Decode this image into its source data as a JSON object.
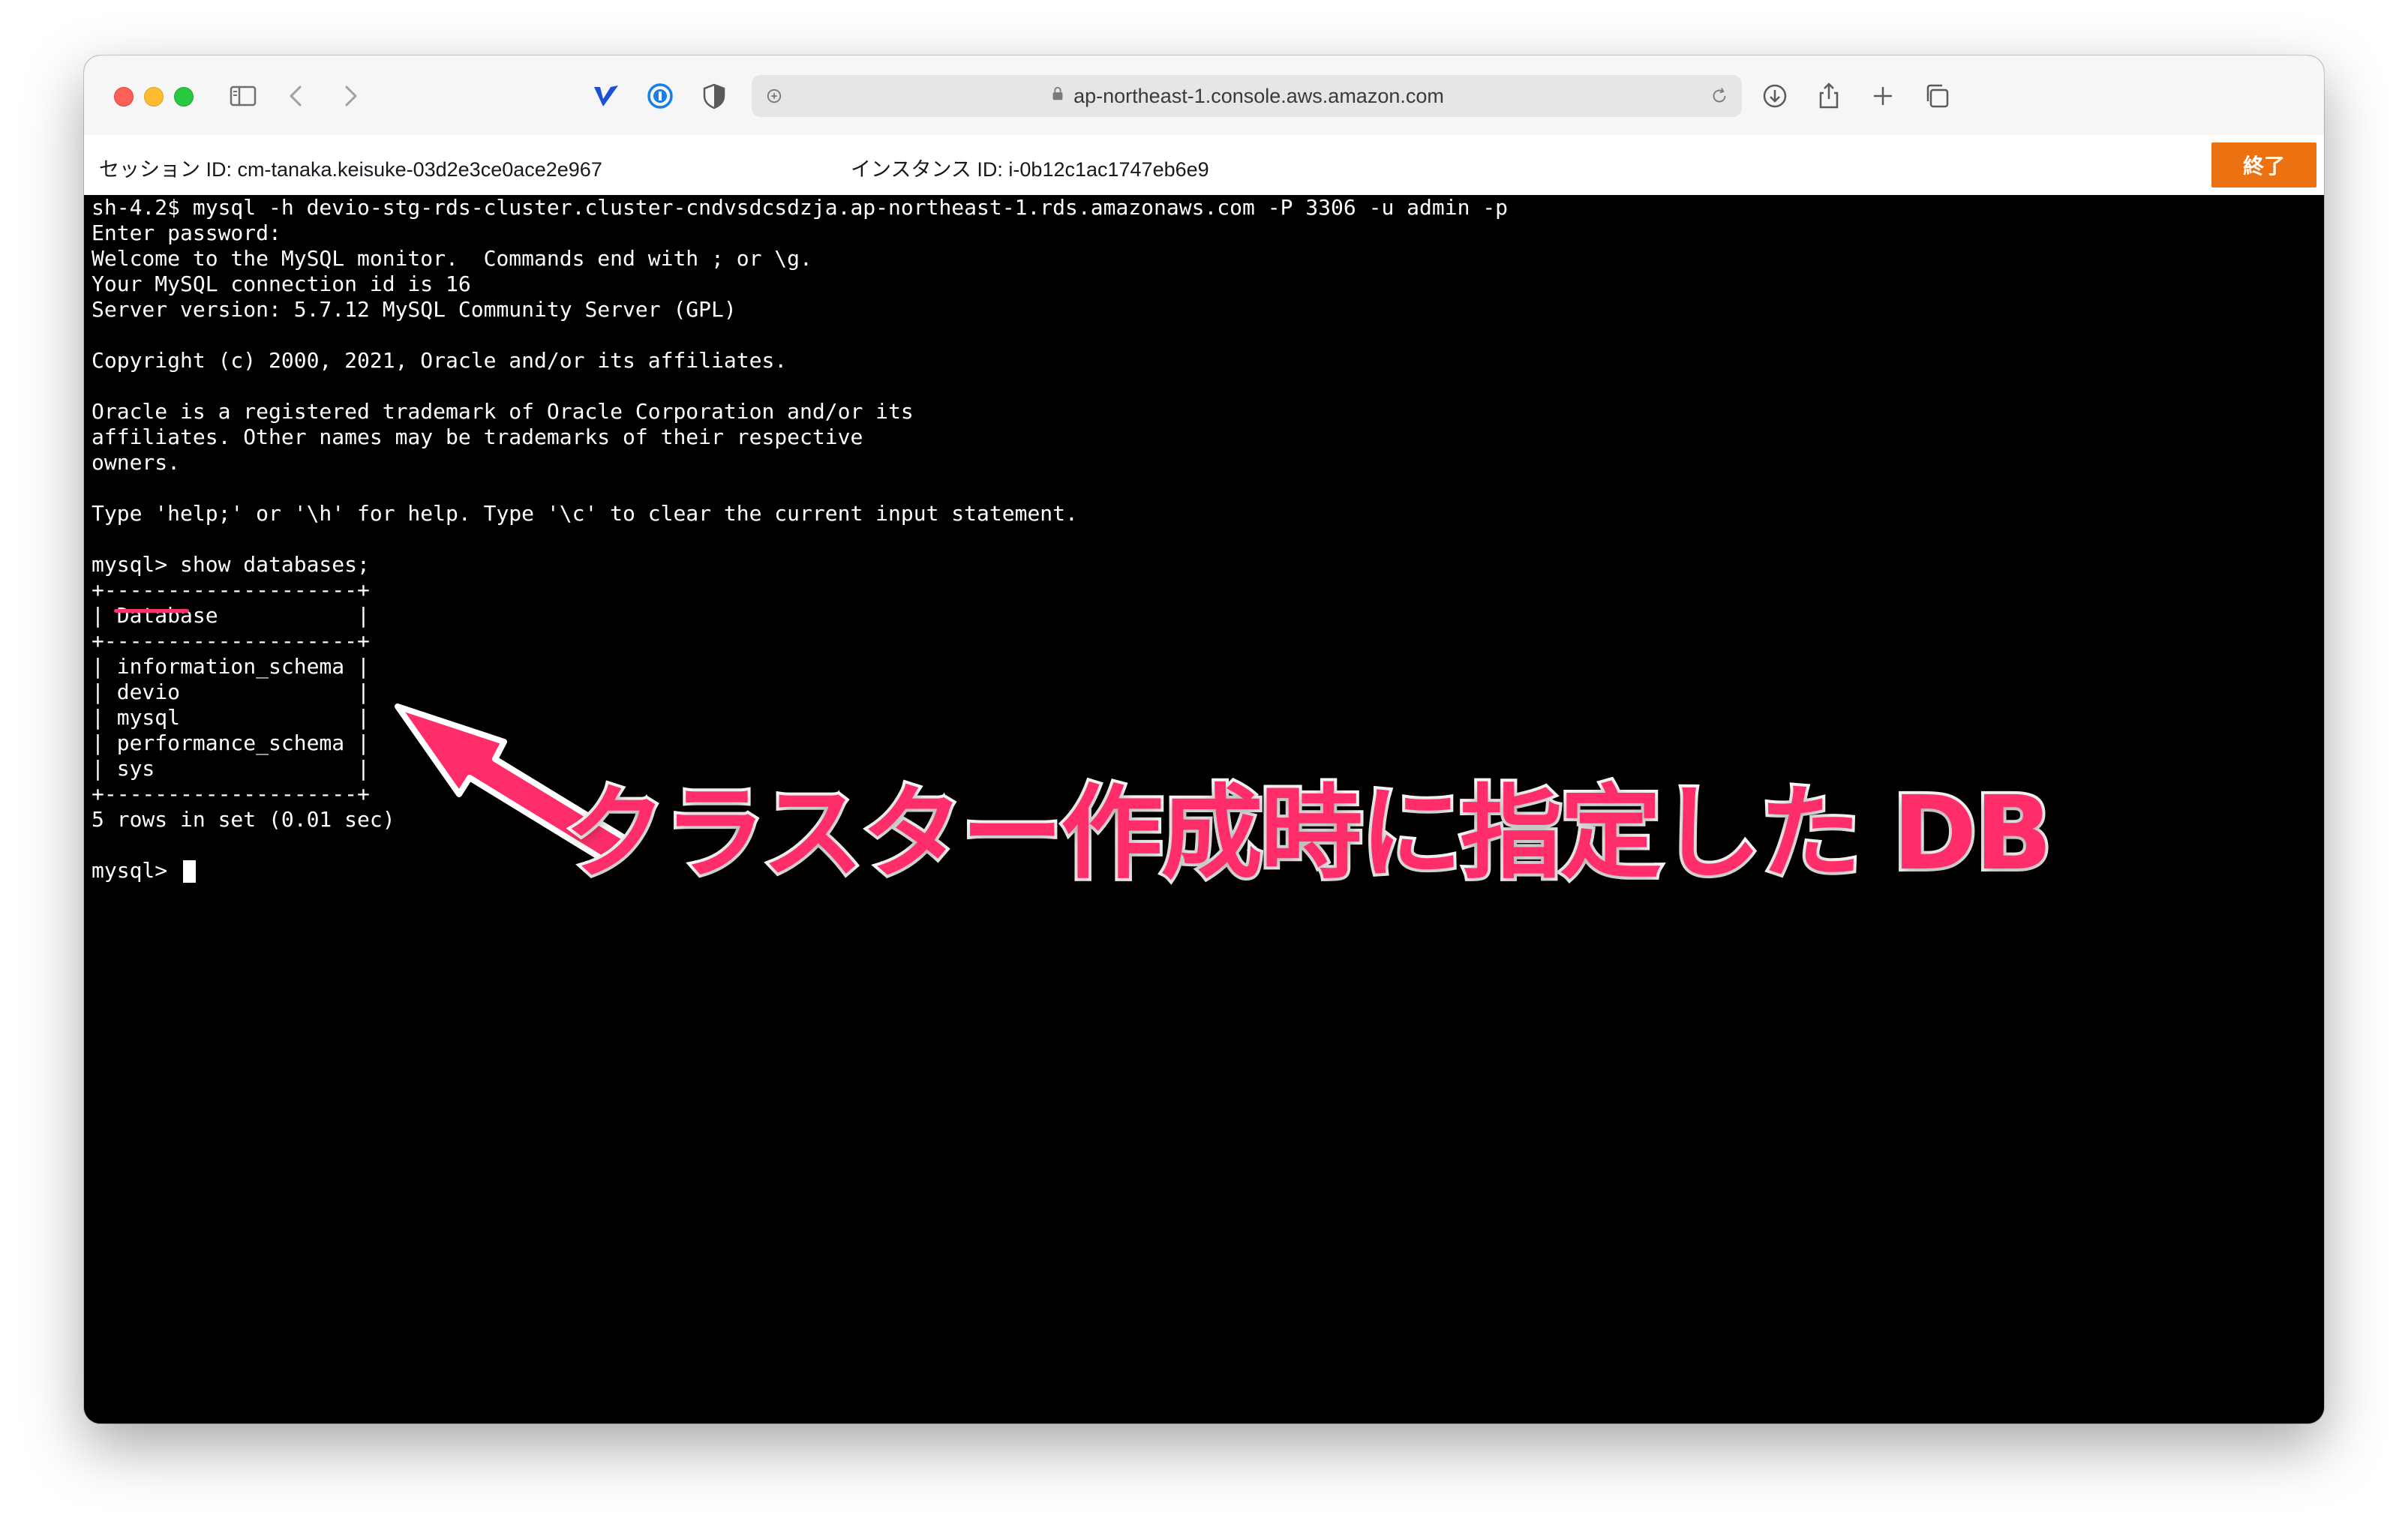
{
  "browser": {
    "url": "ap-northeast-1.console.aws.amazon.com"
  },
  "session": {
    "session_id_label": "セッション ID: cm-tanaka.keisuke-03d2e3ce0ace2e967",
    "instance_id_label": "インスタンス ID: i-0b12c1ac1747eb6e9",
    "end_button_label": "終了",
    "end_button_color": "#ec7211"
  },
  "terminal": {
    "lines": [
      "sh-4.2$ mysql -h devio-stg-rds-cluster.cluster-cndvsdcsdzja.ap-northeast-1.rds.amazonaws.com -P 3306 -u admin -p",
      "Enter password:",
      "Welcome to the MySQL monitor.  Commands end with ; or \\g.",
      "Your MySQL connection id is 16",
      "Server version: 5.7.12 MySQL Community Server (GPL)",
      "",
      "Copyright (c) 2000, 2021, Oracle and/or its affiliates.",
      "",
      "Oracle is a registered trademark of Oracle Corporation and/or its",
      "affiliates. Other names may be trademarks of their respective",
      "owners.",
      "",
      "Type 'help;' or '\\h' for help. Type '\\c' to clear the current input statement.",
      "",
      "mysql> show databases;",
      "+--------------------+",
      "| Database           |",
      "+--------------------+",
      "| information_schema |",
      "| devio              |",
      "| mysql              |",
      "| performance_schema |",
      "| sys                |",
      "+--------------------+",
      "5 rows in set (0.01 sec)",
      "",
      "mysql> "
    ]
  },
  "annotation": {
    "text": "クラスター作成時に指定した DB",
    "color": "#ff2e6a"
  },
  "icons": [
    "sidebar-icon",
    "back-chevron-icon",
    "forward-chevron-icon",
    "extension-v-icon",
    "password-manager-icon",
    "shield-icon",
    "lock-icon",
    "reload-icon",
    "download-icon",
    "share-icon",
    "new-tab-plus-icon",
    "tabs-overview-icon"
  ]
}
